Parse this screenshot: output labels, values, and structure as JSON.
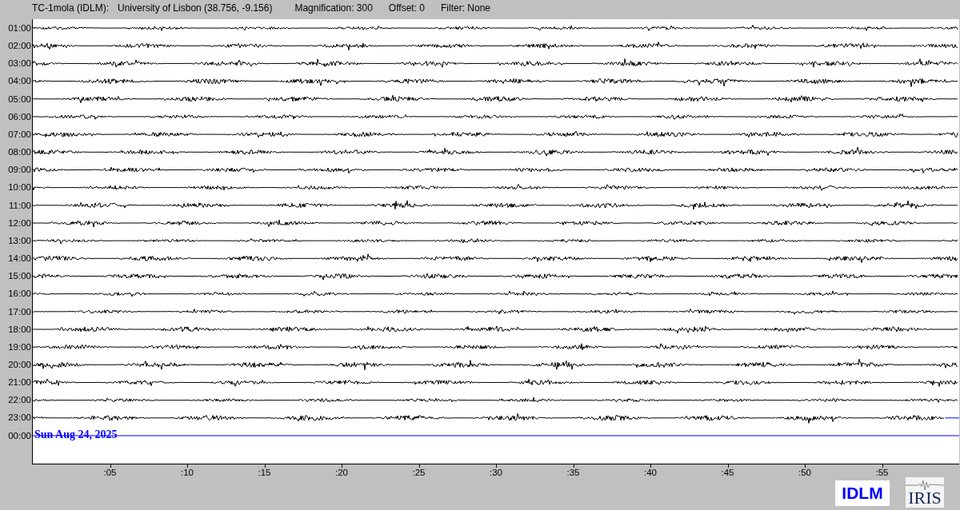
{
  "header": {
    "station": "TC-1mola (IDLM):",
    "location": "University of Lisbon (38.756, -9.156)",
    "magnification": "Magnification: 300",
    "offset": "Offset: 0",
    "filter": "Filter: None"
  },
  "rows": [
    {
      "label": "01:00",
      "kind": "full"
    },
    {
      "label": "02:00",
      "kind": "full"
    },
    {
      "label": "03:00",
      "kind": "full"
    },
    {
      "label": "04:00",
      "kind": "full"
    },
    {
      "label": "05:00",
      "kind": "full"
    },
    {
      "label": "06:00",
      "kind": "full"
    },
    {
      "label": "07:00",
      "kind": "full"
    },
    {
      "label": "08:00",
      "kind": "full"
    },
    {
      "label": "09:00",
      "kind": "full"
    },
    {
      "label": "10:00",
      "kind": "full"
    },
    {
      "label": "11:00",
      "kind": "full"
    },
    {
      "label": "12:00",
      "kind": "full"
    },
    {
      "label": "13:00",
      "kind": "full"
    },
    {
      "label": "14:00",
      "kind": "full"
    },
    {
      "label": "15:00",
      "kind": "full"
    },
    {
      "label": "16:00",
      "kind": "full"
    },
    {
      "label": "17:00",
      "kind": "full"
    },
    {
      "label": "18:00",
      "kind": "full"
    },
    {
      "label": "19:00",
      "kind": "full"
    },
    {
      "label": "20:00",
      "kind": "full"
    },
    {
      "label": "21:00",
      "kind": "full"
    },
    {
      "label": "22:00",
      "kind": "full"
    },
    {
      "label": "23:00",
      "kind": "partial",
      "level": 0.984
    },
    {
      "label": "00:00",
      "kind": "current",
      "date": "Sun Aug 24, 2025"
    }
  ],
  "x_ticks": [
    ":05",
    ":10",
    ":15",
    ":20",
    ":25",
    ":30",
    ":35",
    ":40",
    ":45",
    ":50",
    ":55"
  ],
  "logos": [
    {
      "text": "IDLM",
      "kind": "station"
    },
    {
      "text": "IRIS",
      "kind": "network"
    }
  ]
}
